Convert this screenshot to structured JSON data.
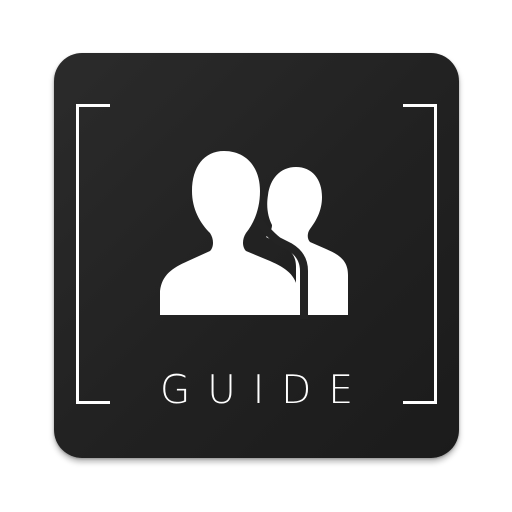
{
  "app_icon": {
    "label": "GUIDE",
    "icon": "users-icon",
    "colors": {
      "background": "#222222",
      "foreground": "#ffffff"
    }
  }
}
